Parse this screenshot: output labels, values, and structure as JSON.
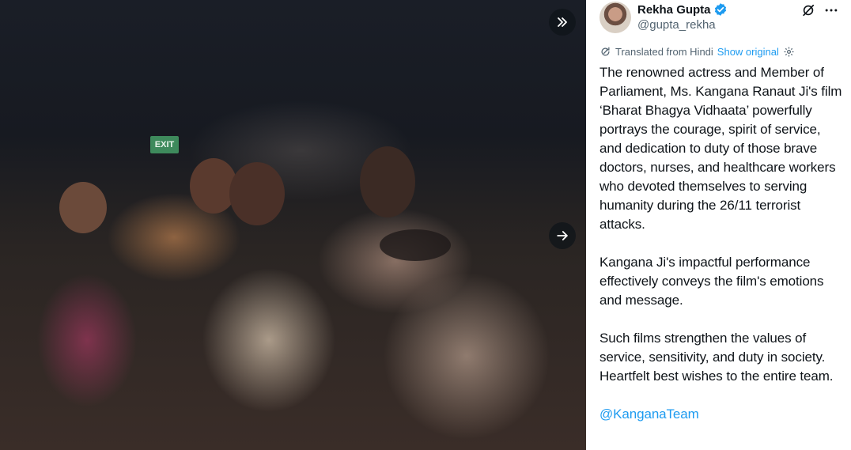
{
  "media": {
    "exit_sign": "EXIT",
    "collapse_icon": "double-chevron-right-icon",
    "next_icon": "arrow-right-icon"
  },
  "tweet": {
    "author": {
      "name": "Rekha Gupta",
      "handle": "@gupta_rekha",
      "verified": true
    },
    "translation": {
      "label": "Translated from Hindi",
      "show_original": "Show original"
    },
    "paragraphs": [
      "The renowned actress and Member of Parliament, Ms. Kangana Ranaut Ji's film ‘Bharat Bhagya Vidhaata’ powerfully portrays the courage, spirit of service, and dedication to duty of those brave doctors, nurses, and healthcare workers who devoted themselves to serving humanity during the 26/11 terrorist attacks.",
      "Kangana Ji's impactful performance effectively conveys the film's emotions and message.",
      "Such films strengthen the values of service, sensitivity, and duty in society. Heartfelt best wishes to the entire team."
    ],
    "mention": "@KanganaTeam"
  },
  "colors": {
    "accent": "#1d9bf0",
    "text": "#0f1419",
    "secondary": "#536471"
  }
}
